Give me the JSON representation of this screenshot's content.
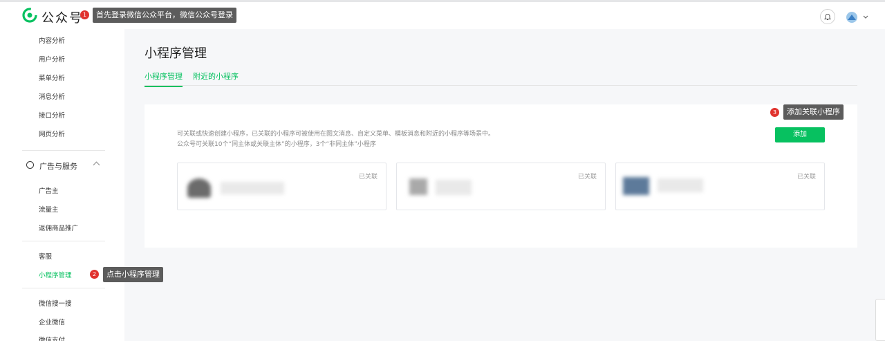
{
  "header": {
    "brand": "公众号",
    "icons": {
      "logo": "wechat-official-account-logo",
      "bell": "bell-icon",
      "avatar": "avatar"
    },
    "accent": "#07c160"
  },
  "annotations": [
    {
      "num": "1",
      "text": "首先登录微信公众平台，微信公众号登录"
    },
    {
      "num": "2",
      "text": "点击小程序管理"
    },
    {
      "num": "3",
      "text": "添加关联小程序"
    }
  ],
  "sidebar": {
    "analytics": [
      "内容分析",
      "用户分析",
      "菜单分析",
      "消息分析",
      "接口分析",
      "网页分析"
    ],
    "group": {
      "label": "广告与服务",
      "icon": "compass-icon"
    },
    "ads": [
      "广告主",
      "流量主",
      "返佣商品推广"
    ],
    "service": [
      "客服",
      "小程序管理"
    ],
    "more": [
      "微信搜一搜",
      "企业微信",
      "微信支付"
    ]
  },
  "main": {
    "title": "小程序管理",
    "tabs": [
      "小程序管理",
      "附近的小程序"
    ],
    "desc_line1": "可关联或快速创建小程序，已关联的小程序可被使用在图文消息、自定义菜单、模板消息和附近的小程序等场景中。",
    "desc_line2": "公众号可关联10个“同主体或关联主体”的小程序，3个“非同主体”小程序",
    "add_label": "添加",
    "cards": [
      {
        "status": "已关联"
      },
      {
        "status": "已关联"
      },
      {
        "status": "已关联"
      }
    ]
  }
}
